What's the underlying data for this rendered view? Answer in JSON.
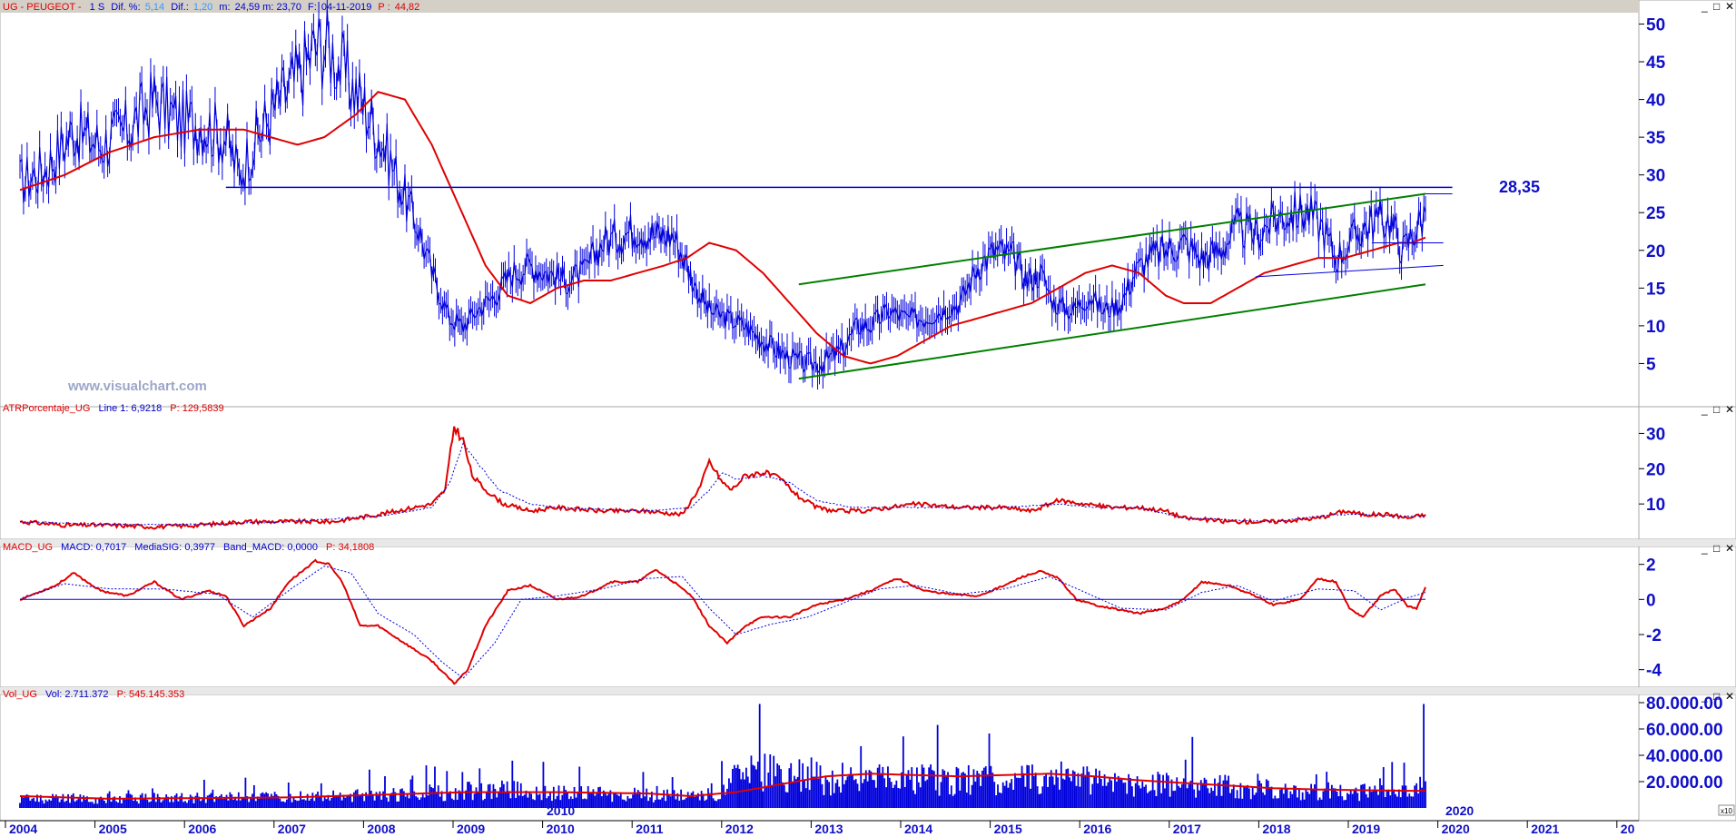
{
  "colors": {
    "price": "#0000dd",
    "ma": "#e00000",
    "channel": "#008000",
    "axis_text": "#1010c8",
    "header_red": "#e00000"
  },
  "watermark": "www.visualchart.com",
  "window_controls": [
    "_",
    "□",
    "✕"
  ],
  "price_panel": {
    "header": {
      "symbol": "UG - PEUGEOT -",
      "period": "1 S",
      "dif_pct_label": "Dif. %:",
      "dif_pct": "5,14",
      "dif_label": "Dif.:",
      "dif": "1,20",
      "m_label": "m:",
      "m": "24,59 m: 23,70",
      "f_label": "F:",
      "f": "04-11-2019",
      "p_label": "P :",
      "p": "44,82"
    },
    "level_label": "28,35"
  },
  "atr_panel": {
    "header": {
      "name": "ATRPorcentaje_UG",
      "line": "Line 1: 6,9218",
      "p": "P: 129,5839"
    }
  },
  "macd_panel": {
    "header": {
      "name": "MACD_UG",
      "macd": "MACD: 0,7017",
      "sig": "MediaSIG: 0,3977",
      "band": "Band_MACD: 0,0000",
      "p": "P: 34,1808"
    }
  },
  "vol_panel": {
    "header": {
      "name": "Vol_UG",
      "vol": "Vol: 2.711.372",
      "p": "P: 545.145.353"
    },
    "scale_note": "x10"
  },
  "chart_data": [
    {
      "type": "line",
      "panel": "price",
      "title": "UG - PEUGEOT - 1 S",
      "x_unit": "year",
      "y_ticks": [
        "5",
        "10",
        "15",
        "20",
        "25",
        "30",
        "35",
        "40",
        "45",
        "50"
      ],
      "ylim": [
        0,
        51.5
      ],
      "series": [
        {
          "role": "price",
          "x": [
            2004.0,
            2004.3,
            2004.6,
            2004.9,
            2005.2,
            2005.5,
            2005.8,
            2006.0,
            2006.3,
            2006.45,
            2006.6,
            2006.85,
            2007.1,
            2007.3,
            2007.45,
            2007.6,
            2007.85,
            2008.1,
            2008.3,
            2008.45,
            2008.6,
            2008.8,
            2008.95,
            2009.1,
            2009.3,
            2009.5,
            2009.7,
            2009.9,
            2010.1,
            2010.3,
            2010.5,
            2010.7,
            2010.9,
            2011.1,
            2011.3,
            2011.45,
            2011.55,
            2011.7,
            2011.9,
            2012.1,
            2012.3,
            2012.55,
            2012.75,
            2012.95,
            2013.2,
            2013.35,
            2013.5,
            2013.7,
            2013.9,
            2014.1,
            2014.3,
            2014.5,
            2014.7,
            2014.9,
            2015.1,
            2015.25,
            2015.4,
            2015.55,
            2015.75,
            2015.95,
            2016.1,
            2016.3,
            2016.45,
            2016.6,
            2016.8,
            2017.0,
            2017.2,
            2017.4,
            2017.6,
            2017.8,
            2018.0,
            2018.2,
            2018.4,
            2018.55,
            2018.7,
            2018.85,
            2019.0,
            2019.15,
            2019.3,
            2019.45,
            2019.55,
            2019.7
          ],
          "values": [
            29,
            31,
            36,
            34,
            36,
            40,
            37,
            37,
            35,
            30,
            34,
            39,
            43,
            47,
            47,
            44,
            39,
            33,
            27,
            23,
            17,
            11,
            10,
            12,
            14,
            17,
            18,
            17,
            16,
            17,
            21,
            22,
            23,
            22,
            22,
            18,
            15,
            12,
            11,
            10,
            8,
            6,
            5,
            5,
            7,
            10,
            10,
            12,
            11,
            11,
            12,
            13,
            18,
            20,
            19,
            16,
            17,
            13,
            12,
            14,
            12,
            13,
            17,
            19,
            20,
            21,
            19,
            20,
            23,
            22,
            24,
            25,
            25,
            23,
            19,
            21,
            23,
            24,
            24,
            20,
            22,
            25
          ]
        },
        {
          "role": "moving-average",
          "x": [
            2004.0,
            2004.5,
            2005.0,
            2005.5,
            2006.0,
            2006.5,
            2006.8,
            2007.1,
            2007.4,
            2007.75,
            2008.0,
            2008.3,
            2008.6,
            2008.9,
            2009.2,
            2009.45,
            2009.7,
            2010.0,
            2010.3,
            2010.6,
            2010.9,
            2011.2,
            2011.45,
            2011.7,
            2012.0,
            2012.3,
            2012.6,
            2012.9,
            2013.2,
            2013.5,
            2013.8,
            2014.1,
            2014.4,
            2014.7,
            2015.0,
            2015.3,
            2015.6,
            2015.9,
            2016.2,
            2016.5,
            2016.8,
            2017.0,
            2017.3,
            2017.6,
            2017.9,
            2018.2,
            2018.5,
            2018.8,
            2019.1,
            2019.4,
            2019.55,
            2019.7
          ],
          "values": [
            28,
            30,
            33,
            35,
            36,
            36,
            35,
            34,
            35,
            38,
            41,
            40,
            34,
            26,
            18,
            14,
            13,
            15,
            16,
            16,
            17,
            18,
            19,
            21,
            20,
            17,
            13,
            9,
            6,
            5,
            6,
            8,
            10,
            11,
            12,
            13,
            15,
            17,
            18,
            17,
            14,
            13,
            13,
            15,
            17,
            18,
            19,
            19,
            20,
            21,
            21,
            21.7
          ]
        },
        {
          "role": "resistance",
          "x": [
            2006.3,
            2020.0
          ],
          "values": [
            28.35,
            28.35
          ]
        },
        {
          "role": "channel-upper",
          "x": [
            2012.7,
            2019.7
          ],
          "values": [
            15.5,
            27.5
          ]
        },
        {
          "role": "channel-lower",
          "x": [
            2012.7,
            2019.7
          ],
          "values": [
            3.0,
            15.5
          ]
        },
        {
          "role": "support",
          "x": [
            2017.8,
            2019.9
          ],
          "values": [
            16.5,
            18.0
          ]
        },
        {
          "role": "flat-high",
          "x": [
            2019.7,
            2020.0
          ],
          "values": [
            27.5,
            27.5
          ]
        },
        {
          "role": "flat-mid",
          "x": [
            2019.1,
            2019.9
          ],
          "values": [
            21.0,
            21.0
          ]
        }
      ]
    },
    {
      "type": "line",
      "panel": "atr",
      "title": "ATRPorcentaje_UG",
      "y_ticks": [
        "10",
        "20",
        "30"
      ],
      "ylim": [
        0,
        35
      ],
      "series": [
        {
          "role": "atr",
          "x": [
            2004.0,
            2004.5,
            2005.0,
            2005.5,
            2006.0,
            2006.5,
            2007.0,
            2007.5,
            2008.0,
            2008.4,
            2008.6,
            2008.75,
            2008.85,
            2008.95,
            2009.05,
            2009.2,
            2009.4,
            2009.7,
            2010.0,
            2010.5,
            2011.0,
            2011.4,
            2011.6,
            2011.7,
            2011.85,
            2011.95,
            2012.1,
            2012.3,
            2012.5,
            2012.7,
            2012.9,
            2013.1,
            2013.4,
            2013.7,
            2014.0,
            2014.5,
            2015.0,
            2015.3,
            2015.6,
            2015.9,
            2016.2,
            2016.5,
            2016.8,
            2017.0,
            2017.5,
            2018.0,
            2018.5,
            2018.8,
            2019.0,
            2019.3,
            2019.5,
            2019.7
          ],
          "values": [
            5,
            4,
            4,
            3.5,
            4,
            5,
            5,
            5,
            7,
            9,
            10,
            14,
            32,
            28,
            18,
            14,
            10,
            8,
            9,
            8,
            8,
            7,
            15,
            22,
            16,
            14,
            18,
            19,
            17,
            12,
            9,
            8,
            8,
            9,
            10,
            9,
            9,
            8,
            11,
            10,
            9,
            9,
            8,
            6,
            5,
            5,
            6,
            8,
            7,
            7,
            6,
            7
          ]
        },
        {
          "role": "signal",
          "x": [
            2004.0,
            2005.0,
            2006.0,
            2007.0,
            2008.0,
            2008.6,
            2008.8,
            2008.95,
            2009.1,
            2009.35,
            2009.7,
            2010.0,
            2011.0,
            2011.5,
            2011.7,
            2011.85,
            2012.0,
            2012.3,
            2012.6,
            2012.9,
            2013.3,
            2014.0,
            2015.0,
            2015.6,
            2016.0,
            2016.5,
            2017.0,
            2018.0,
            2018.7,
            2019.0,
            2019.5,
            2019.7
          ],
          "values": [
            5,
            4.2,
            4.2,
            5,
            6.5,
            9,
            16,
            27,
            22,
            14,
            10,
            9,
            8,
            9,
            14,
            19,
            17,
            18,
            16,
            11,
            9,
            9,
            9,
            10,
            9,
            9,
            6,
            5,
            7,
            7,
            6.5,
            6.8
          ]
        }
      ]
    },
    {
      "type": "line",
      "panel": "macd",
      "title": "MACD_UG",
      "y_ticks": [
        "-4",
        "-2",
        "0",
        "2"
      ],
      "ylim": [
        -5,
        2.5
      ],
      "series": [
        {
          "role": "macd",
          "x": [
            2004.0,
            2004.4,
            2004.6,
            2004.9,
            2005.2,
            2005.5,
            2005.8,
            2006.1,
            2006.3,
            2006.5,
            2006.8,
            2007.0,
            2007.3,
            2007.45,
            2007.6,
            2007.8,
            2008.0,
            2008.3,
            2008.6,
            2008.85,
            2009.0,
            2009.2,
            2009.45,
            2009.7,
            2010.0,
            2010.3,
            2010.6,
            2010.9,
            2011.1,
            2011.3,
            2011.5,
            2011.7,
            2011.9,
            2012.1,
            2012.3,
            2012.6,
            2012.9,
            2013.2,
            2013.5,
            2013.8,
            2014.1,
            2014.4,
            2014.7,
            2015.0,
            2015.2,
            2015.4,
            2015.6,
            2015.8,
            2016.0,
            2016.3,
            2016.5,
            2016.8,
            2017.0,
            2017.2,
            2017.5,
            2017.8,
            2018.0,
            2018.3,
            2018.5,
            2018.7,
            2018.85,
            2019.0,
            2019.2,
            2019.35,
            2019.5,
            2019.6,
            2019.7
          ],
          "values": [
            0,
            0.8,
            1.5,
            0.5,
            0.2,
            1,
            0,
            0.5,
            0.2,
            -1.5,
            -0.5,
            1,
            2.2,
            2,
            1,
            -1.5,
            -1.5,
            -2.5,
            -3.5,
            -4.8,
            -4,
            -1.5,
            0.5,
            0.8,
            0,
            0.2,
            1,
            1,
            1.7,
            1,
            0.2,
            -1.5,
            -2.5,
            -1.5,
            -1,
            -1,
            -0.3,
            0,
            0.5,
            1.2,
            0.5,
            0.3,
            0.2,
            0.8,
            1.3,
            1.6,
            1.2,
            0,
            -0.3,
            -0.6,
            -0.8,
            -0.5,
            0,
            1,
            0.8,
            0.2,
            -0.3,
            0,
            1.2,
            1,
            -0.5,
            -1,
            0.2,
            0.6,
            -0.4,
            -0.5,
            0.7
          ]
        },
        {
          "role": "signal",
          "x": [
            2004.0,
            2004.5,
            2005.0,
            2005.6,
            2006.2,
            2006.6,
            2007.0,
            2007.4,
            2007.7,
            2008.0,
            2008.4,
            2008.7,
            2008.95,
            2009.3,
            2009.6,
            2010.0,
            2010.5,
            2011.0,
            2011.4,
            2011.7,
            2012.0,
            2012.4,
            2012.8,
            2013.2,
            2013.6,
            2014.0,
            2014.5,
            2015.0,
            2015.5,
            2015.9,
            2016.3,
            2016.8,
            2017.2,
            2017.6,
            2018.0,
            2018.5,
            2018.9,
            2019.2,
            2019.5,
            2019.7
          ],
          "values": [
            0,
            0.9,
            0.6,
            0.6,
            0.3,
            -1,
            0.5,
            1.9,
            1.5,
            -0.8,
            -2,
            -3.5,
            -4.5,
            -2.5,
            0,
            0.2,
            0.6,
            1.2,
            1.3,
            -0.5,
            -2,
            -1.4,
            -1,
            -0.2,
            0.6,
            0.8,
            0.3,
            0.6,
            1.3,
            0.4,
            -0.5,
            -0.6,
            0.4,
            0.8,
            -0.1,
            0.6,
            0.5,
            -0.6,
            0.1,
            0.4
          ]
        },
        {
          "role": "zero",
          "x": [
            2004.0,
            2019.7
          ],
          "values": [
            0,
            0
          ]
        }
      ]
    },
    {
      "type": "bar",
      "panel": "volume",
      "title": "Vol_UG",
      "y_ticks": [
        "20.000.00",
        "40.000.00",
        "60.000.00",
        "80.000.00"
      ],
      "ylim": [
        0,
        80000
      ],
      "series": [
        {
          "role": "volume-envelope",
          "x": [
            2004.0,
            2005.0,
            2006.0,
            2007.0,
            2008.0,
            2008.5,
            2009.0,
            2009.5,
            2010.0,
            2010.5,
            2011.0,
            2011.5,
            2011.8,
            2012.0,
            2012.3,
            2012.5,
            2012.8,
            2013.0,
            2013.3,
            2013.6,
            2014.0,
            2014.5,
            2015.0,
            2015.5,
            2015.8,
            2016.0,
            2016.5,
            2017.0,
            2017.5,
            2018.0,
            2018.5,
            2019.0,
            2019.5,
            2019.7
          ],
          "values": [
            9000,
            9000,
            9500,
            10000,
            12000,
            14000,
            16000,
            17000,
            14000,
            13000,
            12000,
            11000,
            13000,
            28000,
            35000,
            30000,
            32000,
            26000,
            30000,
            28000,
            27000,
            26000,
            27000,
            28000,
            30000,
            25000,
            23000,
            22000,
            20000,
            17000,
            16000,
            15000,
            14000,
            38000
          ]
        },
        {
          "role": "volume-ma",
          "x": [
            2004.0,
            2005.0,
            2006.0,
            2007.0,
            2008.0,
            2009.0,
            2010.0,
            2011.0,
            2011.5,
            2012.0,
            2012.5,
            2013.0,
            2013.5,
            2014.0,
            2014.5,
            2015.0,
            2015.5,
            2016.0,
            2016.5,
            2017.0,
            2017.5,
            2018.0,
            2018.5,
            2019.0,
            2019.5,
            2019.7
          ],
          "values": [
            9000,
            7000,
            7500,
            8000,
            10000,
            12000,
            12000,
            11000,
            9000,
            12000,
            18000,
            24000,
            26000,
            25000,
            24000,
            25000,
            26000,
            24000,
            21000,
            19000,
            17000,
            15000,
            14000,
            13500,
            13000,
            13000
          ]
        }
      ]
    }
  ],
  "x_axis": {
    "ticks": [
      "2004",
      "2005",
      "2006",
      "2007",
      "2008",
      "2009",
      "2010",
      "2011",
      "2012",
      "2013",
      "2014",
      "2015",
      "2016",
      "2017",
      "2018",
      "2019",
      "2020",
      "2021",
      "20"
    ],
    "inner_labels": [
      "2010",
      "2020"
    ]
  }
}
